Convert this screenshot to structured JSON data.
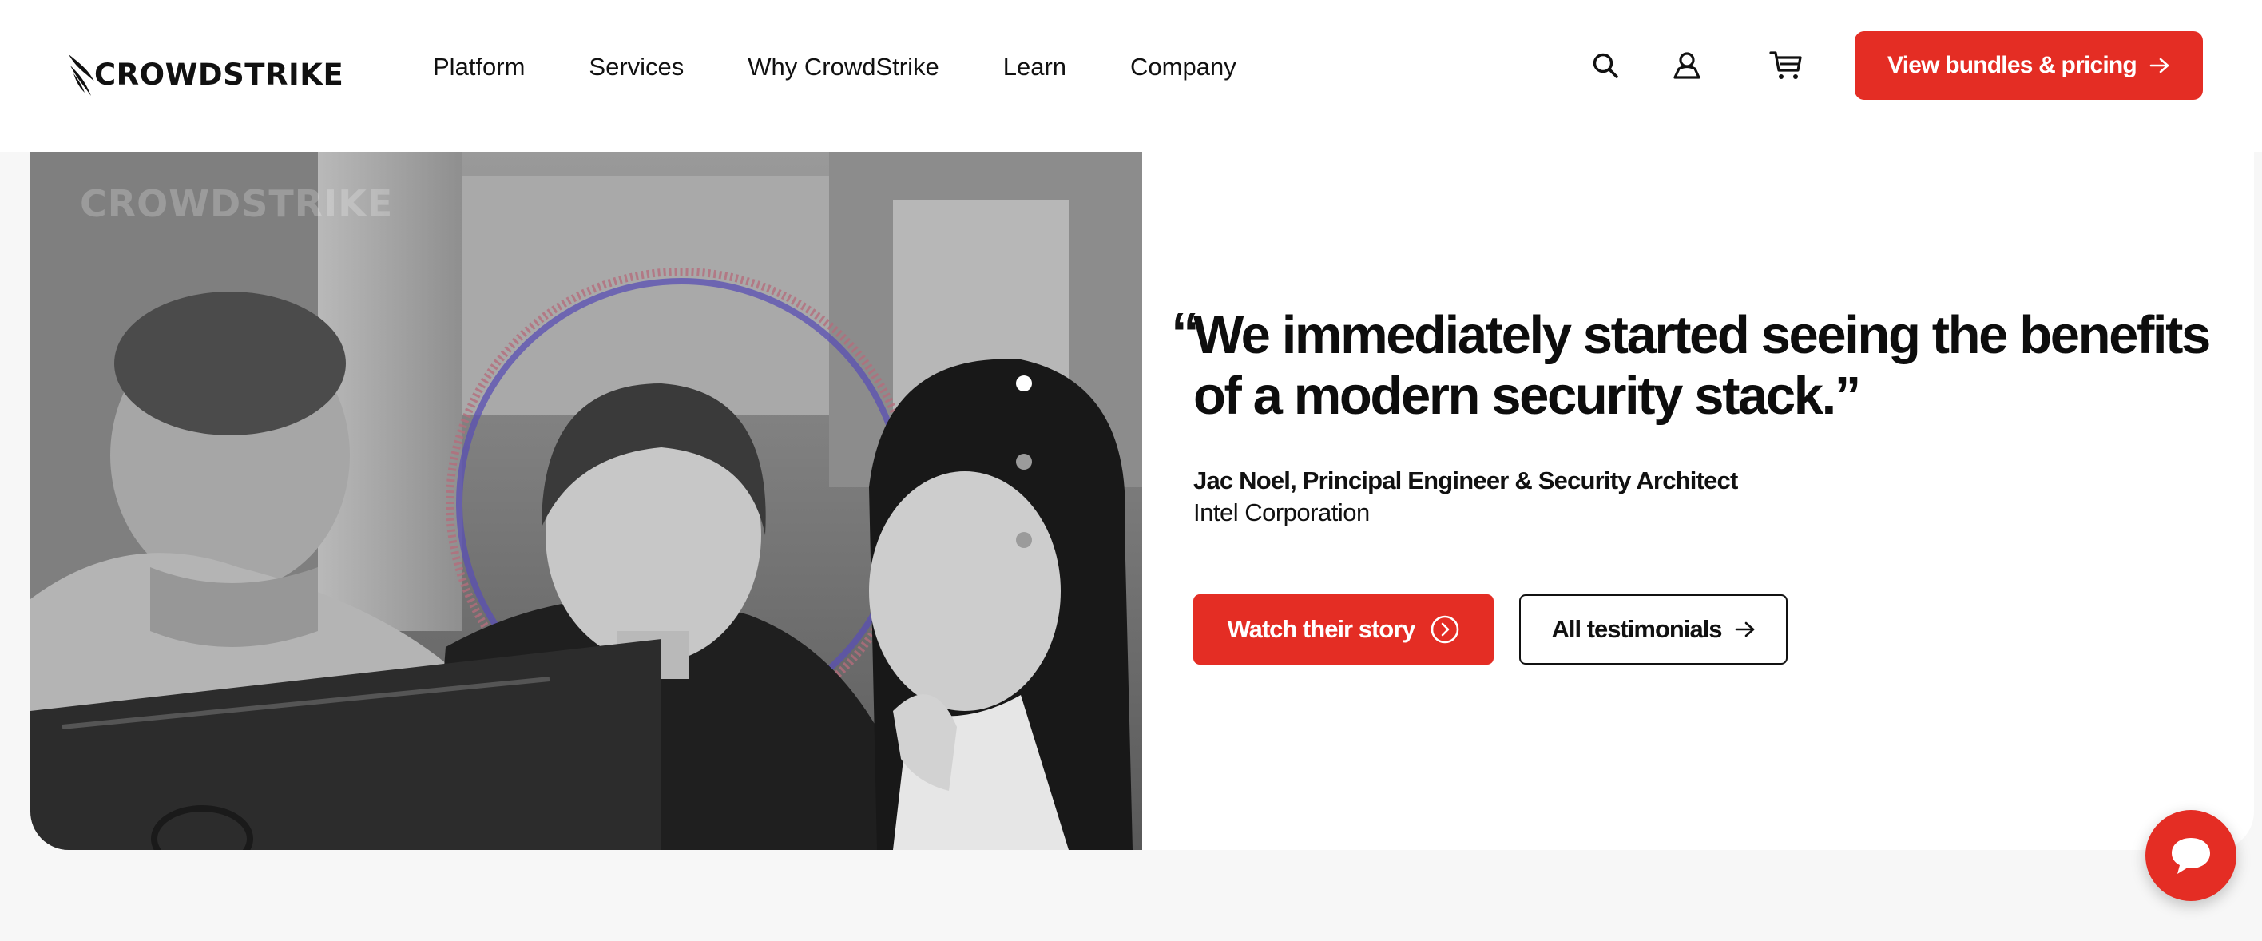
{
  "brand": {
    "name": "CROWDSTRIKE",
    "accent_color": "#e42d24"
  },
  "nav": {
    "items": [
      "Platform",
      "Services",
      "Why CrowdStrike",
      "Learn",
      "Company"
    ]
  },
  "header_icons": [
    "search-icon",
    "user-icon",
    "cart-icon"
  ],
  "header_cta": {
    "label": "View bundles & pricing",
    "icon": "arrow-right-icon"
  },
  "hero": {
    "photo_watermark": "CROWDSTRIKE",
    "carousel": {
      "slides": 3,
      "active_index": 0
    },
    "quote_open": "“",
    "quote": "We immediately started seeing the benefits of a modern security stack.”",
    "author": "Jac Noel, Principal Engineer & Security Architect",
    "company": "Intel Corporation",
    "primary_button": {
      "label": "Watch their story",
      "icon": "play-circle-icon"
    },
    "secondary_button": {
      "label": "All testimonials",
      "icon": "arrow-right-icon"
    }
  },
  "chat": {
    "icon": "chat-bubble-icon"
  }
}
